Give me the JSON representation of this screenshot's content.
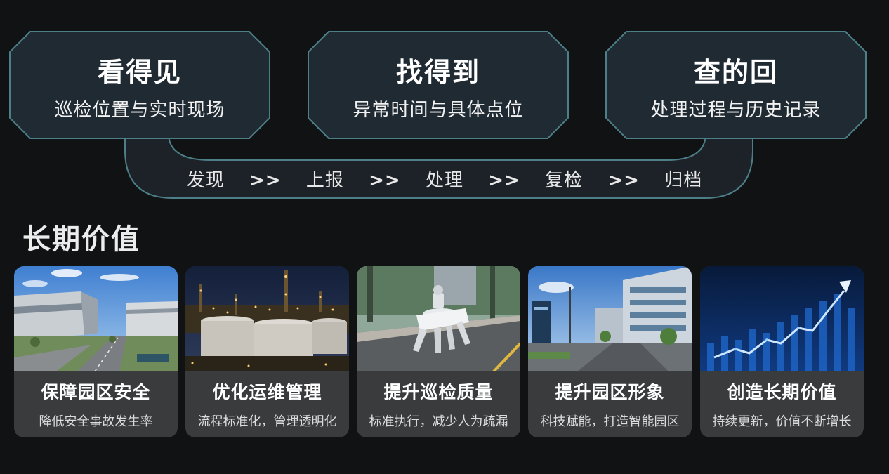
{
  "panels": [
    {
      "title": "看得见",
      "subtitle": "巡检位置与实时现场"
    },
    {
      "title": "找得到",
      "subtitle": "异常时间与具体点位"
    },
    {
      "title": "查的回",
      "subtitle": "处理过程与历史记录"
    }
  ],
  "flow": {
    "steps": [
      "发现",
      "上报",
      "处理",
      "复检",
      "归档"
    ],
    "separator": ">>"
  },
  "section_title": "长期价值",
  "cards": [
    {
      "title": "保障园区安全",
      "subtitle": "降低安全事故发生率",
      "image": "industrial-park-photo"
    },
    {
      "title": "优化运维管理",
      "subtitle": "流程标准化，管理透明化",
      "image": "refinery-night-photo"
    },
    {
      "title": "提升巡检质量",
      "subtitle": "标准执行，减少人为疏漏",
      "image": "robot-dog-photo"
    },
    {
      "title": "提升园区形象",
      "subtitle": "科技赋能，打造智能园区",
      "image": "smart-park-street-photo"
    },
    {
      "title": "创造长期价值",
      "subtitle": "持续更新，价值不断增长",
      "image": "growth-chart-photo"
    }
  ],
  "colors": {
    "background": "#111214",
    "panel_fill": "#1f2a33",
    "panel_stroke": "#4d7f89",
    "card_fill": "#3a3b3d"
  }
}
